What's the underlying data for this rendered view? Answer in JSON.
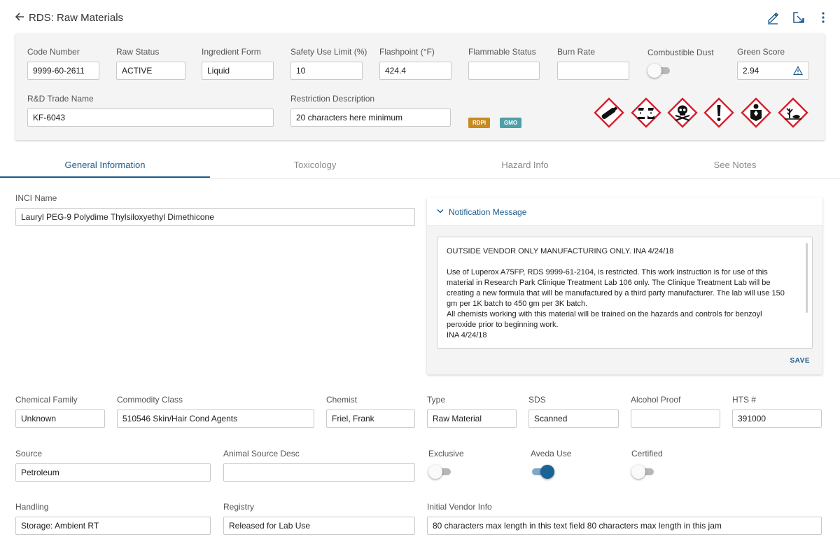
{
  "header": {
    "title": "RDS: Raw Materials",
    "icons": [
      "back-arrow-icon",
      "pencil-icon",
      "open-in-new-icon",
      "more-vertical-icon"
    ]
  },
  "summary": {
    "code_number": {
      "label": "Code Number",
      "value": "9999-60-2611"
    },
    "raw_status": {
      "label": "Raw Status",
      "value": "ACTIVE"
    },
    "ingredient_form": {
      "label": "Ingredient Form",
      "value": "Liquid"
    },
    "safety_use_limit": {
      "label": "Safety Use Limit (%)",
      "value": "10"
    },
    "flashpoint": {
      "label": "Flashpoint (°F)",
      "value": "424.4"
    },
    "flammable_status": {
      "label": "Flammable Status",
      "value": ""
    },
    "burn_rate": {
      "label": "Burn Rate",
      "value": ""
    },
    "combustible_dust": {
      "label": "Combustible Dust",
      "on": false
    },
    "green_score": {
      "label": "Green Score",
      "value": "2.94",
      "icon": "warning-triangle-icon"
    },
    "trade_name": {
      "label": "R&D Trade Name",
      "value": "KF-6043"
    },
    "restriction": {
      "label": "Restriction Description",
      "value": "20 characters here minimum"
    },
    "badges": [
      {
        "text": "RDPI",
        "color": "#c98a1e"
      },
      {
        "text": "GMO",
        "color": "#4f9fa6"
      }
    ],
    "hazard_pictograms": [
      "gas-cylinder-icon",
      "corrosion-icon",
      "skull-crossbones-icon",
      "exclamation-mark-icon",
      "health-hazard-icon",
      "environment-icon"
    ],
    "hazard_color": "#d81e2c"
  },
  "tabs": [
    {
      "label": "General Information",
      "active": true
    },
    {
      "label": "Toxicology",
      "active": false
    },
    {
      "label": "Hazard Info",
      "active": false
    },
    {
      "label": "See Notes",
      "active": false
    }
  ],
  "general": {
    "inci_name": {
      "label": "INCI Name",
      "value": "Lauryl PEG-9 Polydime Thylsiloxyethyl Dimethicone"
    },
    "notification": {
      "title": "Notification Message",
      "paragraph1": "OUTSIDE VENDOR ONLY MANUFACTURING ONLY.  INA 4/24/18",
      "paragraph2_lines": [
        "Use of Luperox A75FP, RDS 9999-61-2104, is restricted. This work instruction is for use of this",
        "material in Research Park Clinique Treatment Lab 106 only. The Clinique Treatment Lab will be",
        "creating a new formula that will be manufactured by a third party manufacturer.  The lab will use 150",
        "gm per 1K batch to 450 gm per 3K batch.",
        "All chemists working with this material will be trained on the hazards and controls for benzoyl",
        "peroxide prior to beginning work.",
        "INA 4/24/18"
      ],
      "save_label": "SAVE"
    },
    "chemical_family": {
      "label": "Chemical Family",
      "value": "Unknown"
    },
    "commodity_class": {
      "label": "Commodity Class",
      "value": "510546 Skin/Hair Cond Agents"
    },
    "chemist": {
      "label": "Chemist",
      "value": "Friel, Frank"
    },
    "type": {
      "label": "Type",
      "value": "Raw Material"
    },
    "sds": {
      "label": "SDS",
      "value": "Scanned"
    },
    "alcohol_proof": {
      "label": "Alcohol Proof",
      "value": ""
    },
    "hts": {
      "label": "HTS #",
      "value": "391000"
    },
    "source": {
      "label": "Source",
      "value": "Petroleum"
    },
    "animal_source_desc": {
      "label": "Animal Source Desc",
      "value": ""
    },
    "exclusive": {
      "label": "Exclusive",
      "on": false
    },
    "aveda_use": {
      "label": "Aveda Use",
      "on": true
    },
    "certified": {
      "label": "Certified",
      "on": false
    },
    "handling": {
      "label": "Handling",
      "value": "Storage: Ambient RT"
    },
    "registry": {
      "label": "Registry",
      "value": "Released for Lab Use"
    },
    "initial_vendor_info": {
      "label": "Initial Vendor Info",
      "value": "80 characters max length in this text field 80 characters max length in this jam"
    }
  },
  "colors": {
    "accent": "#1e5c8d",
    "card_bg": "#f4f4f4"
  }
}
